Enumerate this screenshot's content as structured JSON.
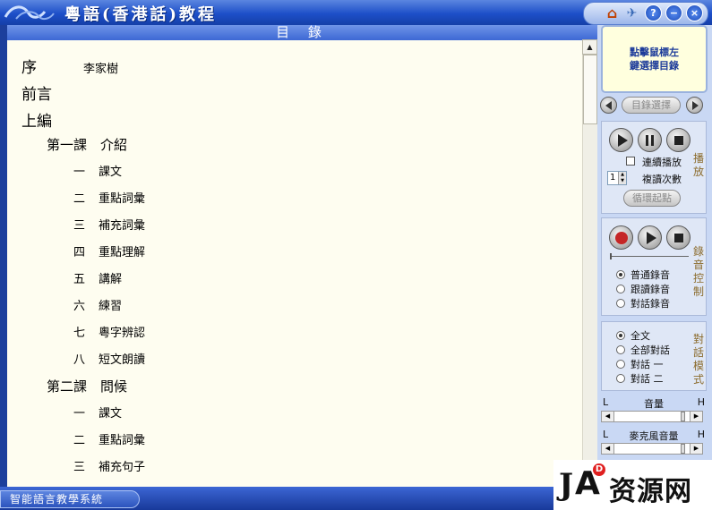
{
  "window": {
    "title": "粵語(香港話)教程",
    "controls": {
      "home": "home-icon",
      "favorite": "bird-icon",
      "help": "?",
      "minimize": "−",
      "close": "×"
    }
  },
  "section_header": "目 錄",
  "toc": [
    {
      "level": 0,
      "num": "",
      "label": "序",
      "author": "李家樹"
    },
    {
      "level": 0,
      "num": "",
      "label": "前言"
    },
    {
      "level": 0,
      "num": "",
      "label": "上編"
    },
    {
      "level": 1,
      "num": "",
      "label": "第一課　介紹"
    },
    {
      "level": 2,
      "num": "一",
      "label": "課文"
    },
    {
      "level": 2,
      "num": "二",
      "label": "重點詞彙"
    },
    {
      "level": 2,
      "num": "三",
      "label": "補充詞彙"
    },
    {
      "level": 2,
      "num": "四",
      "label": "重點理解"
    },
    {
      "level": 2,
      "num": "五",
      "label": "講解"
    },
    {
      "level": 2,
      "num": "六",
      "label": "練習"
    },
    {
      "level": 2,
      "num": "七",
      "label": "粵字辨認"
    },
    {
      "level": 2,
      "num": "八",
      "label": "短文朗讀"
    },
    {
      "level": 1,
      "num": "",
      "label": "第二課　問候"
    },
    {
      "level": 2,
      "num": "一",
      "label": "課文"
    },
    {
      "level": 2,
      "num": "二",
      "label": "重點詞彙"
    },
    {
      "level": 2,
      "num": "三",
      "label": "補充句子"
    }
  ],
  "sidebar": {
    "hint": "點擊鼠標左\n鍵選擇目錄",
    "toc_select": "目錄選擇",
    "playback": {
      "continuous": "連續播放",
      "repeat_count_label": "複讀次數",
      "repeat_count": "1",
      "loop_start": "循環起點",
      "side_label": "播放"
    },
    "record": {
      "side_label": "錄音控制",
      "modes": [
        "普通錄音",
        "跟讀錄音",
        "對話錄音"
      ],
      "selected": 0
    },
    "dialogue": {
      "side_label": "對話模式",
      "modes": [
        "全文",
        "全部對話",
        "對話 一",
        "對話 二"
      ],
      "selected": 0
    },
    "volume": {
      "l": "L",
      "label": "音量",
      "h": "H"
    },
    "mic_volume": {
      "l": "L",
      "label": "麥克風音量",
      "h": "H"
    }
  },
  "statusbar": {
    "app_name": "智能語言教學系統"
  },
  "watermark": {
    "j": "J",
    "a": "A",
    "d": "D",
    "text": "资源网"
  }
}
